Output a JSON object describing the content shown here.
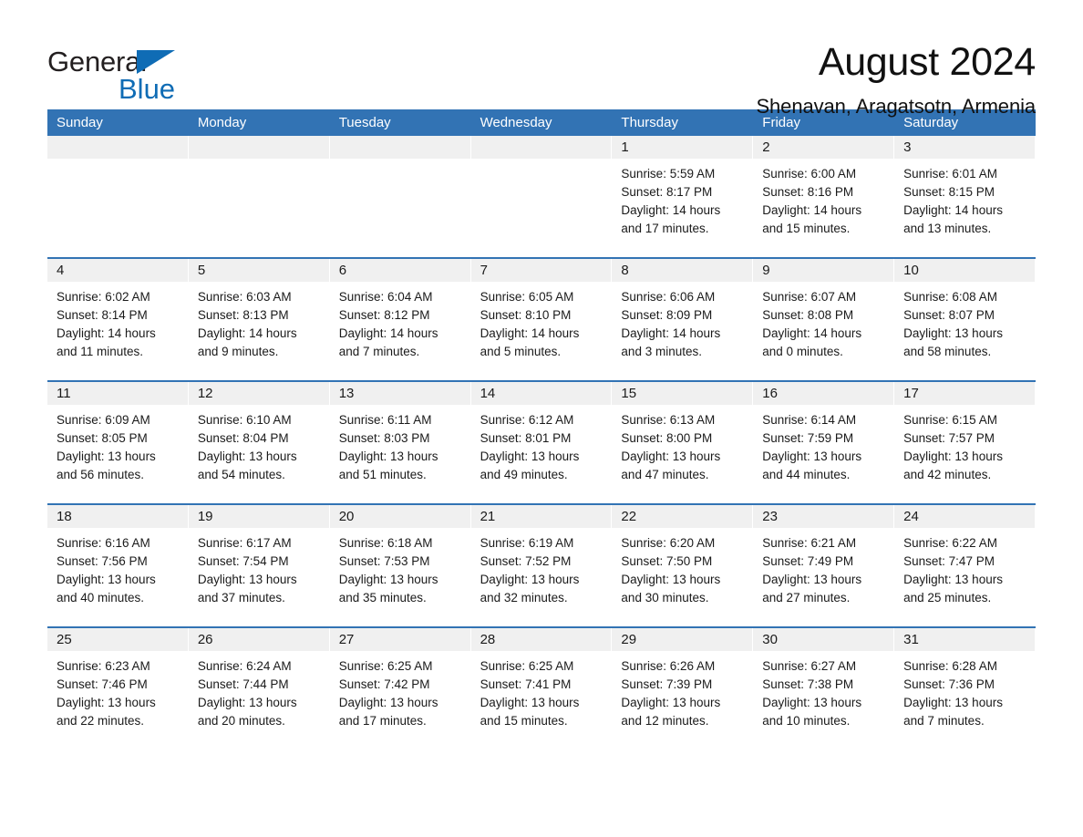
{
  "brand": {
    "name_part1": "General",
    "name_part2": "Blue",
    "accent_color": "#0f6cb5",
    "triangle_icon": "brand-triangle-icon"
  },
  "header": {
    "title": "August 2024",
    "location": "Shenavan, Aragatsotn, Armenia"
  },
  "calendar": {
    "header_color": "#3273b4",
    "weekday_band_color": "#f0f0f0",
    "weekdays": [
      "Sunday",
      "Monday",
      "Tuesday",
      "Wednesday",
      "Thursday",
      "Friday",
      "Saturday"
    ],
    "weeks": [
      [
        {
          "day": "",
          "lines": []
        },
        {
          "day": "",
          "lines": []
        },
        {
          "day": "",
          "lines": []
        },
        {
          "day": "",
          "lines": []
        },
        {
          "day": "1",
          "lines": [
            "Sunrise: 5:59 AM",
            "Sunset: 8:17 PM",
            "Daylight: 14 hours",
            "and 17 minutes."
          ]
        },
        {
          "day": "2",
          "lines": [
            "Sunrise: 6:00 AM",
            "Sunset: 8:16 PM",
            "Daylight: 14 hours",
            "and 15 minutes."
          ]
        },
        {
          "day": "3",
          "lines": [
            "Sunrise: 6:01 AM",
            "Sunset: 8:15 PM",
            "Daylight: 14 hours",
            "and 13 minutes."
          ]
        }
      ],
      [
        {
          "day": "4",
          "lines": [
            "Sunrise: 6:02 AM",
            "Sunset: 8:14 PM",
            "Daylight: 14 hours",
            "and 11 minutes."
          ]
        },
        {
          "day": "5",
          "lines": [
            "Sunrise: 6:03 AM",
            "Sunset: 8:13 PM",
            "Daylight: 14 hours",
            "and 9 minutes."
          ]
        },
        {
          "day": "6",
          "lines": [
            "Sunrise: 6:04 AM",
            "Sunset: 8:12 PM",
            "Daylight: 14 hours",
            "and 7 minutes."
          ]
        },
        {
          "day": "7",
          "lines": [
            "Sunrise: 6:05 AM",
            "Sunset: 8:10 PM",
            "Daylight: 14 hours",
            "and 5 minutes."
          ]
        },
        {
          "day": "8",
          "lines": [
            "Sunrise: 6:06 AM",
            "Sunset: 8:09 PM",
            "Daylight: 14 hours",
            "and 3 minutes."
          ]
        },
        {
          "day": "9",
          "lines": [
            "Sunrise: 6:07 AM",
            "Sunset: 8:08 PM",
            "Daylight: 14 hours",
            "and 0 minutes."
          ]
        },
        {
          "day": "10",
          "lines": [
            "Sunrise: 6:08 AM",
            "Sunset: 8:07 PM",
            "Daylight: 13 hours",
            "and 58 minutes."
          ]
        }
      ],
      [
        {
          "day": "11",
          "lines": [
            "Sunrise: 6:09 AM",
            "Sunset: 8:05 PM",
            "Daylight: 13 hours",
            "and 56 minutes."
          ]
        },
        {
          "day": "12",
          "lines": [
            "Sunrise: 6:10 AM",
            "Sunset: 8:04 PM",
            "Daylight: 13 hours",
            "and 54 minutes."
          ]
        },
        {
          "day": "13",
          "lines": [
            "Sunrise: 6:11 AM",
            "Sunset: 8:03 PM",
            "Daylight: 13 hours",
            "and 51 minutes."
          ]
        },
        {
          "day": "14",
          "lines": [
            "Sunrise: 6:12 AM",
            "Sunset: 8:01 PM",
            "Daylight: 13 hours",
            "and 49 minutes."
          ]
        },
        {
          "day": "15",
          "lines": [
            "Sunrise: 6:13 AM",
            "Sunset: 8:00 PM",
            "Daylight: 13 hours",
            "and 47 minutes."
          ]
        },
        {
          "day": "16",
          "lines": [
            "Sunrise: 6:14 AM",
            "Sunset: 7:59 PM",
            "Daylight: 13 hours",
            "and 44 minutes."
          ]
        },
        {
          "day": "17",
          "lines": [
            "Sunrise: 6:15 AM",
            "Sunset: 7:57 PM",
            "Daylight: 13 hours",
            "and 42 minutes."
          ]
        }
      ],
      [
        {
          "day": "18",
          "lines": [
            "Sunrise: 6:16 AM",
            "Sunset: 7:56 PM",
            "Daylight: 13 hours",
            "and 40 minutes."
          ]
        },
        {
          "day": "19",
          "lines": [
            "Sunrise: 6:17 AM",
            "Sunset: 7:54 PM",
            "Daylight: 13 hours",
            "and 37 minutes."
          ]
        },
        {
          "day": "20",
          "lines": [
            "Sunrise: 6:18 AM",
            "Sunset: 7:53 PM",
            "Daylight: 13 hours",
            "and 35 minutes."
          ]
        },
        {
          "day": "21",
          "lines": [
            "Sunrise: 6:19 AM",
            "Sunset: 7:52 PM",
            "Daylight: 13 hours",
            "and 32 minutes."
          ]
        },
        {
          "day": "22",
          "lines": [
            "Sunrise: 6:20 AM",
            "Sunset: 7:50 PM",
            "Daylight: 13 hours",
            "and 30 minutes."
          ]
        },
        {
          "day": "23",
          "lines": [
            "Sunrise: 6:21 AM",
            "Sunset: 7:49 PM",
            "Daylight: 13 hours",
            "and 27 minutes."
          ]
        },
        {
          "day": "24",
          "lines": [
            "Sunrise: 6:22 AM",
            "Sunset: 7:47 PM",
            "Daylight: 13 hours",
            "and 25 minutes."
          ]
        }
      ],
      [
        {
          "day": "25",
          "lines": [
            "Sunrise: 6:23 AM",
            "Sunset: 7:46 PM",
            "Daylight: 13 hours",
            "and 22 minutes."
          ]
        },
        {
          "day": "26",
          "lines": [
            "Sunrise: 6:24 AM",
            "Sunset: 7:44 PM",
            "Daylight: 13 hours",
            "and 20 minutes."
          ]
        },
        {
          "day": "27",
          "lines": [
            "Sunrise: 6:25 AM",
            "Sunset: 7:42 PM",
            "Daylight: 13 hours",
            "and 17 minutes."
          ]
        },
        {
          "day": "28",
          "lines": [
            "Sunrise: 6:25 AM",
            "Sunset: 7:41 PM",
            "Daylight: 13 hours",
            "and 15 minutes."
          ]
        },
        {
          "day": "29",
          "lines": [
            "Sunrise: 6:26 AM",
            "Sunset: 7:39 PM",
            "Daylight: 13 hours",
            "and 12 minutes."
          ]
        },
        {
          "day": "30",
          "lines": [
            "Sunrise: 6:27 AM",
            "Sunset: 7:38 PM",
            "Daylight: 13 hours",
            "and 10 minutes."
          ]
        },
        {
          "day": "31",
          "lines": [
            "Sunrise: 6:28 AM",
            "Sunset: 7:36 PM",
            "Daylight: 13 hours",
            "and 7 minutes."
          ]
        }
      ]
    ]
  }
}
